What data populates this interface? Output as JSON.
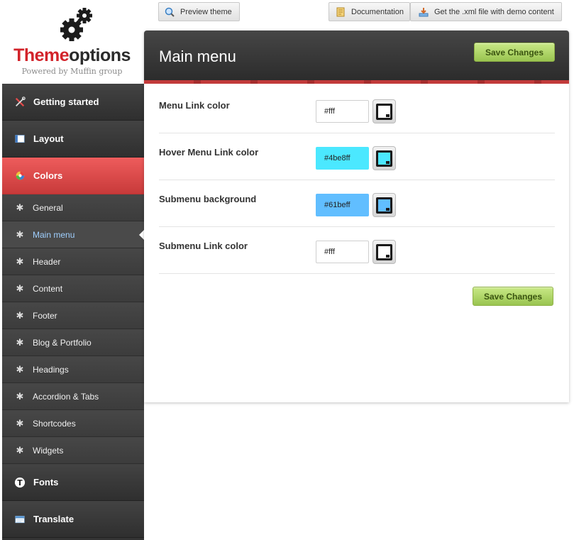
{
  "logo": {
    "brand_part1": "Theme",
    "brand_part2": "options",
    "tagline": "Powered by Muffin group"
  },
  "toolbar": {
    "preview_label": "Preview theme",
    "documentation_label": "Documentation",
    "demo_label": "Get the .xml file with demo content"
  },
  "sidebar": {
    "getting_started": "Getting started",
    "layout": "Layout",
    "colors": "Colors",
    "subitems": [
      "General",
      "Main menu",
      "Header",
      "Content",
      "Footer",
      "Blog & Portfolio",
      "Headings",
      "Accordion & Tabs",
      "Shortcodes",
      "Widgets"
    ],
    "fonts": "Fonts",
    "translate": "Translate"
  },
  "panel": {
    "title": "Main menu",
    "save_label": "Save Changes",
    "fields": [
      {
        "label": "Menu Link color",
        "value": "#fff",
        "color": "#ffffff"
      },
      {
        "label": "Hover Menu Link color",
        "value": "#4be8ff",
        "color": "#4be8ff"
      },
      {
        "label": "Submenu background",
        "value": "#61beff",
        "color": "#61beff"
      },
      {
        "label": "Submenu Link color",
        "value": "#fff",
        "color": "#ffffff"
      }
    ]
  },
  "colors": {
    "accent": "#d2232a",
    "save_green": "#99c450",
    "active_sidebar": "#e04848"
  }
}
